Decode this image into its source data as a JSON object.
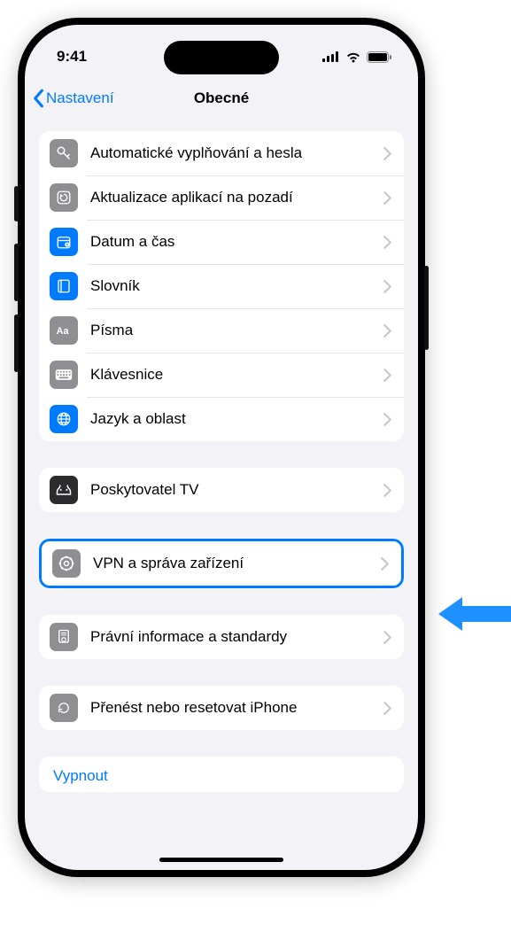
{
  "statusbar": {
    "time": "9:41"
  },
  "navbar": {
    "back": "Nastavení",
    "title": "Obecné"
  },
  "groups": [
    {
      "rows": [
        {
          "icon": "key-icon",
          "color": "gray",
          "label": "Automatické vyplňování a hesla"
        },
        {
          "icon": "refresh-icon",
          "color": "gray",
          "label": "Aktualizace aplikací na pozadí"
        },
        {
          "icon": "calendar-icon",
          "color": "blue",
          "label": "Datum a čas"
        },
        {
          "icon": "book-icon",
          "color": "blue",
          "label": "Slovník"
        },
        {
          "icon": "font-icon",
          "color": "gray",
          "label": "Písma"
        },
        {
          "icon": "keyboard-icon",
          "color": "gray",
          "label": "Klávesnice"
        },
        {
          "icon": "globe-icon",
          "color": "blue",
          "label": "Jazyk a oblast"
        }
      ]
    },
    {
      "rows": [
        {
          "icon": "tv-icon",
          "color": "dark",
          "label": "Poskytovatel TV"
        }
      ]
    },
    {
      "rows": [
        {
          "icon": "gear-icon",
          "color": "gray",
          "label": "VPN a správa zařízení",
          "highlighted": true
        }
      ]
    },
    {
      "rows": [
        {
          "icon": "cert-icon",
          "color": "gray",
          "label": "Právní informace a standardy"
        }
      ]
    },
    {
      "rows": [
        {
          "icon": "reset-icon",
          "color": "gray",
          "label": "Přenést nebo resetovat iPhone"
        }
      ]
    }
  ],
  "footer": {
    "shutdown": "Vypnout"
  }
}
